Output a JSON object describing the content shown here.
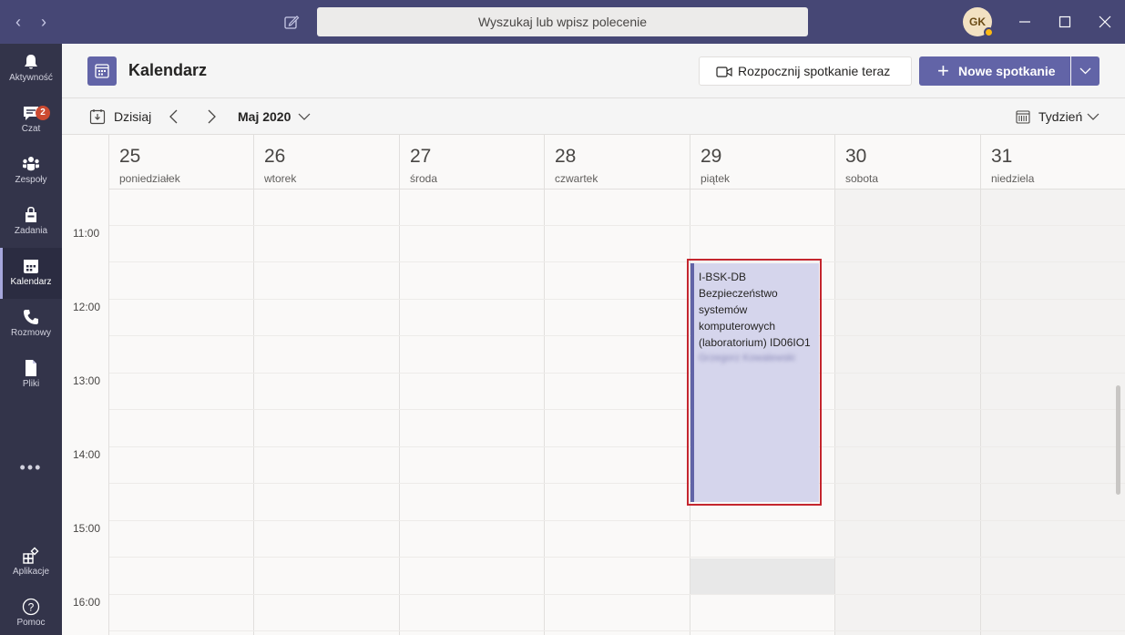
{
  "titlebar": {
    "search_placeholder": "Wyszukaj lub wpisz polecenie",
    "avatar_initials": "GK"
  },
  "rail": {
    "items": [
      {
        "label": "Aktywność",
        "icon": "bell-icon"
      },
      {
        "label": "Czat",
        "icon": "chat-icon",
        "badge": "2"
      },
      {
        "label": "Zespoły",
        "icon": "teams-icon"
      },
      {
        "label": "Zadania",
        "icon": "tasks-icon"
      },
      {
        "label": "Kalendarz",
        "icon": "calendar-icon",
        "active": true
      },
      {
        "label": "Rozmowy",
        "icon": "phone-icon"
      },
      {
        "label": "Pliki",
        "icon": "file-icon"
      },
      {
        "label": "Aplikacje",
        "icon": "apps-icon"
      },
      {
        "label": "Pomoc",
        "icon": "help-icon"
      }
    ],
    "more": "•••"
  },
  "header": {
    "title": "Kalendarz",
    "meet_now_label": "Rozpocznij spotkanie teraz",
    "new_meeting_label": "Nowe spotkanie"
  },
  "toolbar": {
    "today_label": "Dzisiaj",
    "month_label": "Maj 2020",
    "view_label": "Tydzień"
  },
  "days": [
    {
      "num": "25",
      "name": "poniedziałek",
      "weekend": false
    },
    {
      "num": "26",
      "name": "wtorek",
      "weekend": false
    },
    {
      "num": "27",
      "name": "środa",
      "weekend": false
    },
    {
      "num": "28",
      "name": "czwartek",
      "weekend": false
    },
    {
      "num": "29",
      "name": "piątek",
      "weekend": false
    },
    {
      "num": "30",
      "name": "sobota",
      "weekend": true
    },
    {
      "num": "31",
      "name": "niedziela",
      "weekend": true
    }
  ],
  "times": [
    "11:00",
    "12:00",
    "13:00",
    "14:00",
    "15:00",
    "16:00"
  ],
  "event": {
    "lines": [
      "I-BSK-DB",
      "Bezpieczeństwo",
      "systemów",
      "komputerowych",
      "(laboratorium) ID06IO1"
    ],
    "organizer_blurred": "Grzegorz Kowalewski"
  },
  "colors": {
    "titlebar": "#464775",
    "rail": "#33344a",
    "accent": "#6264a7",
    "event_bg": "#d5d5ec",
    "highlight": "#c4262e",
    "badge": "#cc4a31"
  }
}
